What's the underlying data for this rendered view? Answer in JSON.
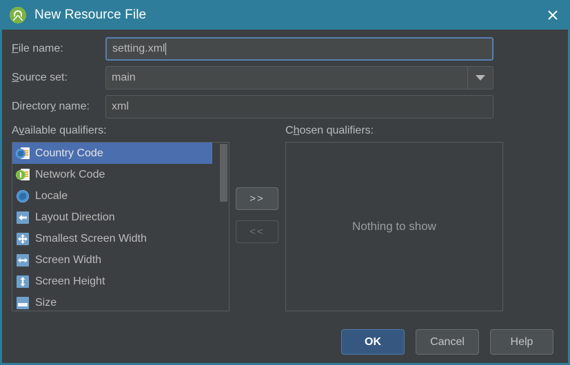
{
  "window": {
    "title": "New Resource File",
    "app_icon": "android-studio-icon",
    "close_icon": "close-icon",
    "titlebar_color": "#2e7d9a",
    "background_color": "#3c3f41"
  },
  "form": {
    "file_name": {
      "label_pre": "F",
      "label_mnemonic": "",
      "label_post": "ile name:",
      "label_full": "File name:",
      "value": "setting.xml"
    },
    "source_set": {
      "label_pre": "",
      "label_mnemonic": "S",
      "label_post": "ource set:",
      "label_full": "Source set:",
      "value": "main",
      "dropdown_icon": "chevron-down-icon"
    },
    "directory_name": {
      "label_pre": "Director",
      "label_mnemonic": "y",
      "label_post": " name:",
      "label_full": "Directory name:",
      "value": "xml"
    }
  },
  "qualifiers": {
    "available_label_pre": "A",
    "available_label_mnemonic": "v",
    "available_label_post": "ailable qualifiers:",
    "available_label_full": "Available qualifiers:",
    "chosen_label_pre": "C",
    "chosen_label_mnemonic": "h",
    "chosen_label_post": "osen qualifiers:",
    "chosen_label_full": "Chosen qualifiers:",
    "available": [
      {
        "label": "Country Code",
        "icon": "globe-document-icon",
        "selected": true
      },
      {
        "label": "Network Code",
        "icon": "network-document-icon",
        "selected": false
      },
      {
        "label": "Locale",
        "icon": "globe-icon",
        "selected": false
      },
      {
        "label": "Layout Direction",
        "icon": "arrow-left-icon",
        "selected": false
      },
      {
        "label": "Smallest Screen Width",
        "icon": "arrows-four-way-icon",
        "selected": false
      },
      {
        "label": "Screen Width",
        "icon": "arrow-horizontal-icon",
        "selected": false
      },
      {
        "label": "Screen Height",
        "icon": "arrow-vertical-icon",
        "selected": false
      },
      {
        "label": "Size",
        "icon": "size-icon",
        "selected": false
      }
    ],
    "chosen": [],
    "chosen_empty_text": "Nothing to show",
    "add_button": ">>",
    "remove_button": "<<",
    "selection_color": "#4b6eaf"
  },
  "footer": {
    "ok": "OK",
    "cancel": "Cancel",
    "help": "Help",
    "default_button_color": "#365880"
  }
}
